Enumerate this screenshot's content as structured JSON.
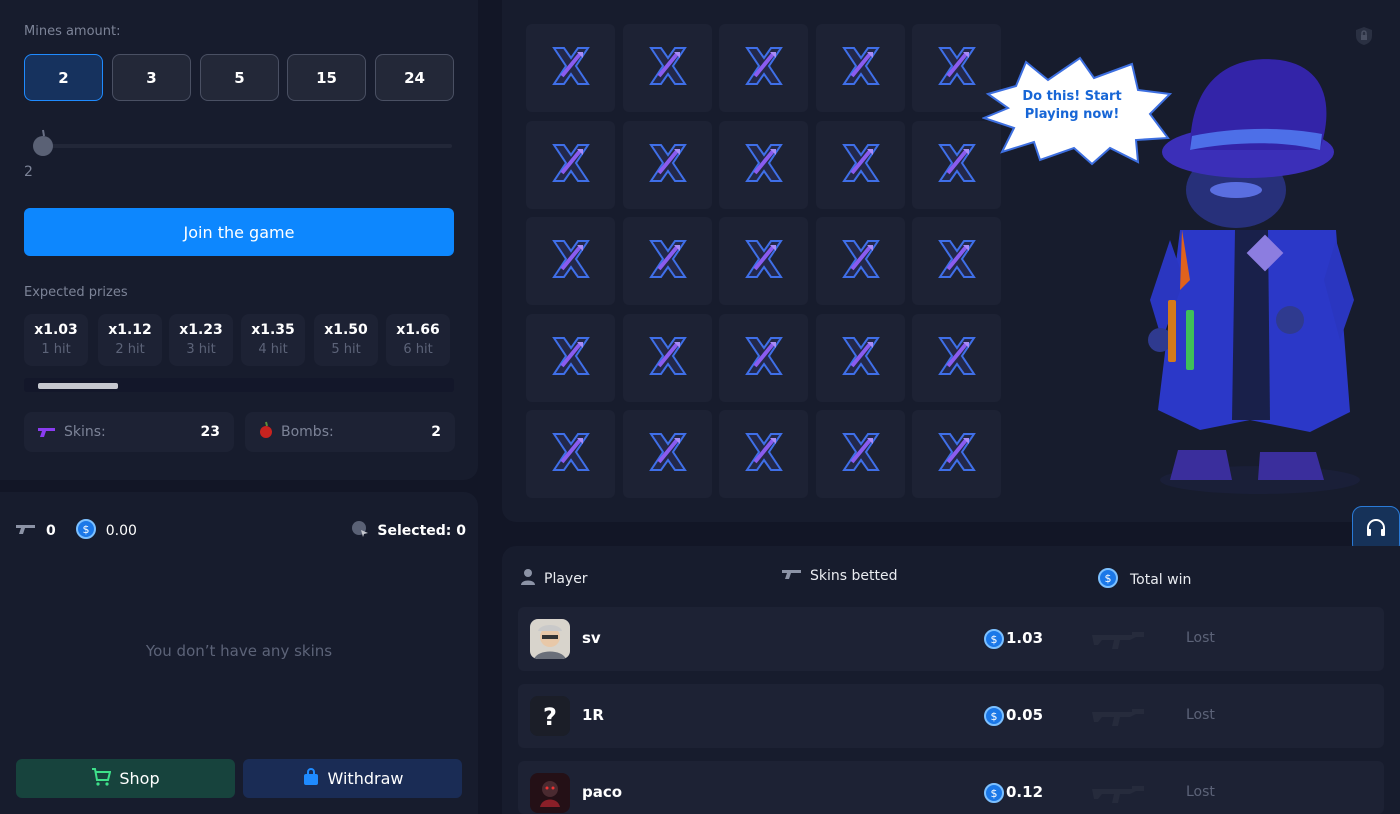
{
  "mines": {
    "label": "Mines amount:",
    "options": [
      "2",
      "3",
      "5",
      "15",
      "24"
    ],
    "selected": "2",
    "slider_min": "2",
    "slider_max": "24",
    "slider_value": 2
  },
  "join_button": "Join the game",
  "prizes": {
    "label": "Expected prizes",
    "items": [
      {
        "mult": "x1.03",
        "hit": "1 hit"
      },
      {
        "mult": "x1.12",
        "hit": "2 hit"
      },
      {
        "mult": "x1.23",
        "hit": "3 hit"
      },
      {
        "mult": "x1.35",
        "hit": "4 hit"
      },
      {
        "mult": "x1.50",
        "hit": "5 hit"
      },
      {
        "mult": "x1.66",
        "hit": "6 hit"
      }
    ],
    "progress_fraction": 0.2
  },
  "stats": {
    "skins_label": "Skins:",
    "skins_value": "23",
    "bombs_label": "Bombs:",
    "bombs_value": "2"
  },
  "inventory": {
    "skins_count": "0",
    "balance": "0.00",
    "selected": "Selected: 0",
    "empty_text": "You don’t have any skins"
  },
  "buttons": {
    "shop": "Shop",
    "withdraw": "Withdraw"
  },
  "board": {
    "rows": 5,
    "cols": 5,
    "speech": "Do this! Start Playing now!"
  },
  "table": {
    "headers": {
      "player": "Player",
      "skins": "Skins betted",
      "total": "Total win"
    },
    "rows": [
      {
        "name": "sv",
        "amount": "1.03",
        "status": "Lost",
        "avatar": "photo-avatar"
      },
      {
        "name": "1R",
        "amount": "0.05",
        "status": "Lost",
        "avatar": "question-avatar"
      },
      {
        "name": "paco",
        "amount": "0.12",
        "status": "Lost",
        "avatar": "dark-avatar"
      }
    ]
  },
  "colors": {
    "accent": "#0d87fe",
    "background": "#121626",
    "panel": "#171c2d",
    "tile": "#1d2234"
  }
}
